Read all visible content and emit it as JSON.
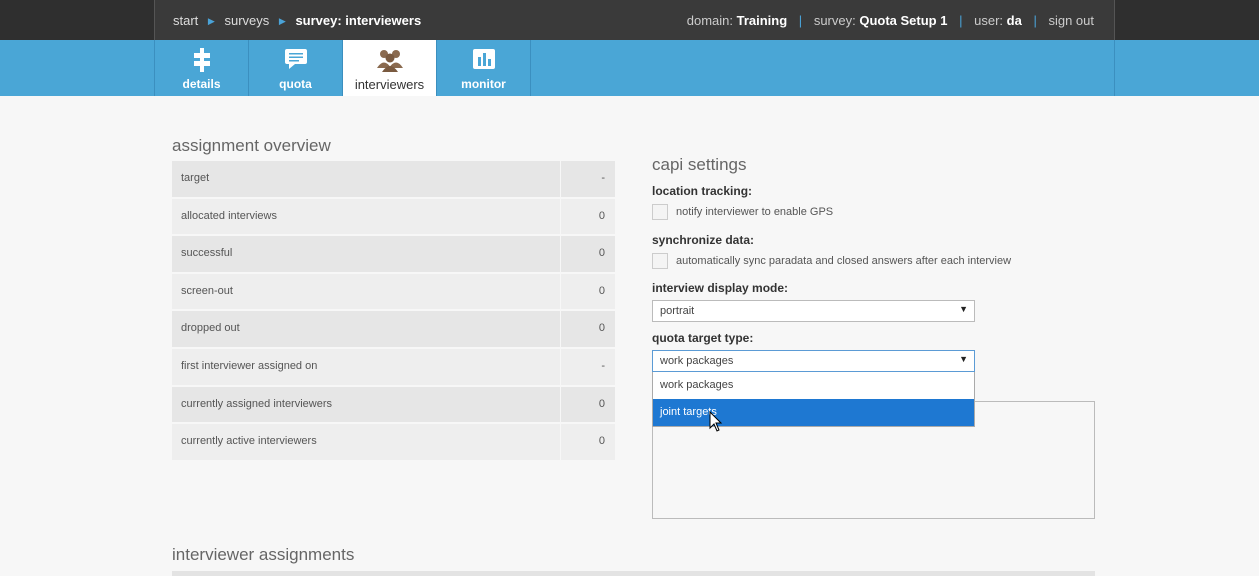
{
  "breadcrumb": {
    "items": [
      "start",
      "surveys"
    ],
    "current": "survey: interviewers"
  },
  "topbar": {
    "domain_label": "domain:",
    "domain_value": "Training",
    "survey_label": "survey:",
    "survey_value": "Quota Setup 1",
    "user_label": "user:",
    "user_value": "da",
    "signout": "sign out"
  },
  "tabs": [
    {
      "label": "details",
      "icon": "details-icon"
    },
    {
      "label": "quota",
      "icon": "quota-icon"
    },
    {
      "label": "interviewers",
      "icon": "interviewers-icon",
      "active": true
    },
    {
      "label": "monitor",
      "icon": "monitor-icon"
    }
  ],
  "overview": {
    "title": "assignment overview",
    "rows": [
      {
        "label": "target",
        "value": "-"
      },
      {
        "label": "allocated interviews",
        "value": "0"
      },
      {
        "label": "successful",
        "value": "0"
      },
      {
        "label": "screen-out",
        "value": "0"
      },
      {
        "label": "dropped out",
        "value": "0"
      },
      {
        "label": "first interviewer assigned on",
        "value": "-"
      },
      {
        "label": "currently assigned interviewers",
        "value": "0"
      },
      {
        "label": "currently active interviewers",
        "value": "0"
      }
    ]
  },
  "capi": {
    "title": "capi settings",
    "location_label": "location tracking:",
    "location_checkbox": "notify interviewer to enable GPS",
    "sync_label": "synchronize data:",
    "sync_checkbox": "automatically sync paradata and closed answers after each interview",
    "display_label": "interview display mode:",
    "display_value": "portrait",
    "quota_label": "quota target type:",
    "quota_value": "work packages",
    "quota_options": [
      "work packages",
      "joint targets"
    ],
    "highlighted_option": "joint targets"
  },
  "assignments": {
    "title": "interviewer assignments"
  },
  "colors": {
    "topbar": "#2f2f2f",
    "nav": "#4aa6d6",
    "highlight": "#1e78d2"
  }
}
